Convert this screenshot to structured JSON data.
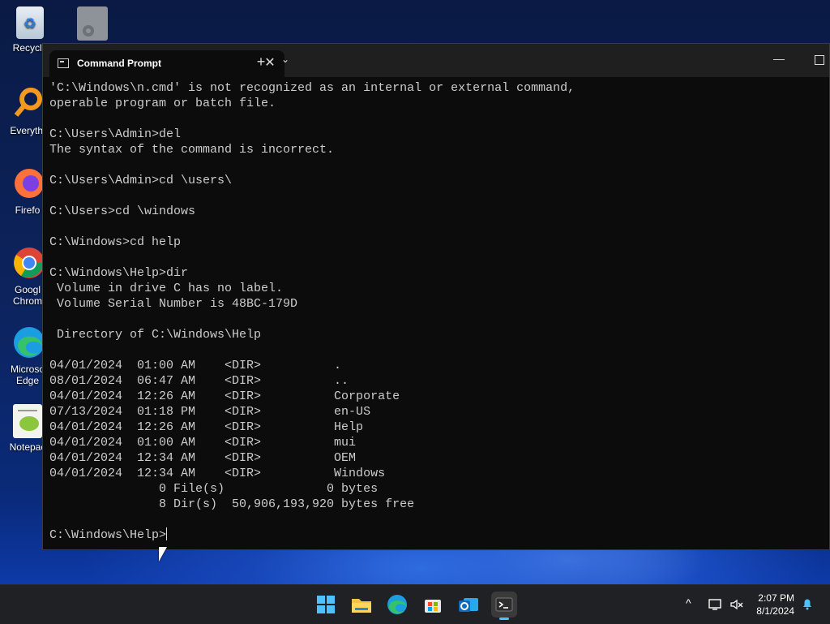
{
  "desktop": {
    "icons": [
      {
        "label": "Recycle"
      },
      {
        "label": ""
      },
      {
        "label": "Everythi"
      },
      {
        "label": "Firefo"
      },
      {
        "label": "Googl"
      },
      {
        "label": "Chrom"
      },
      {
        "label": "Microso"
      },
      {
        "label": "Edge"
      },
      {
        "label": "Notepac"
      }
    ]
  },
  "window": {
    "tab_title": "Command Prompt",
    "close_glyph": "✕",
    "new_tab_glyph": "+",
    "dropdown_glyph": "⌄",
    "minimize_glyph": "—"
  },
  "console": {
    "lines": [
      "'C:\\Windows\\n.cmd' is not recognized as an internal or external command,",
      "operable program or batch file.",
      "",
      "C:\\Users\\Admin>del",
      "The syntax of the command is incorrect.",
      "",
      "C:\\Users\\Admin>cd \\users\\",
      "",
      "C:\\Users>cd \\windows",
      "",
      "C:\\Windows>cd help",
      "",
      "C:\\Windows\\Help>dir",
      " Volume in drive C has no label.",
      " Volume Serial Number is 48BC-179D",
      "",
      " Directory of C:\\Windows\\Help",
      "",
      "04/01/2024  01:00 AM    <DIR>          .",
      "08/01/2024  06:47 AM    <DIR>          ..",
      "04/01/2024  12:26 AM    <DIR>          Corporate",
      "07/13/2024  01:18 PM    <DIR>          en-US",
      "04/01/2024  12:26 AM    <DIR>          Help",
      "04/01/2024  01:00 AM    <DIR>          mui",
      "04/01/2024  12:34 AM    <DIR>          OEM",
      "04/01/2024  12:34 AM    <DIR>          Windows",
      "               0 File(s)              0 bytes",
      "               8 Dir(s)  50,906,193,920 bytes free",
      ""
    ],
    "prompt": "C:\\Windows\\Help>"
  },
  "taskbar": {
    "apps": [
      "start-icon",
      "file-explorer-icon",
      "edge-icon",
      "store-icon",
      "outlook-icon",
      "terminal-icon"
    ],
    "tray": {
      "chevron": "^",
      "time": "2:07 PM",
      "date": "8/1/2024"
    }
  },
  "colors": {
    "console_bg": "#0c0c0c",
    "console_text": "#cccccc",
    "titlebar_bg": "#1f1f1f",
    "taskbar_bg": "#202124",
    "accent": "#4cc2ff"
  }
}
